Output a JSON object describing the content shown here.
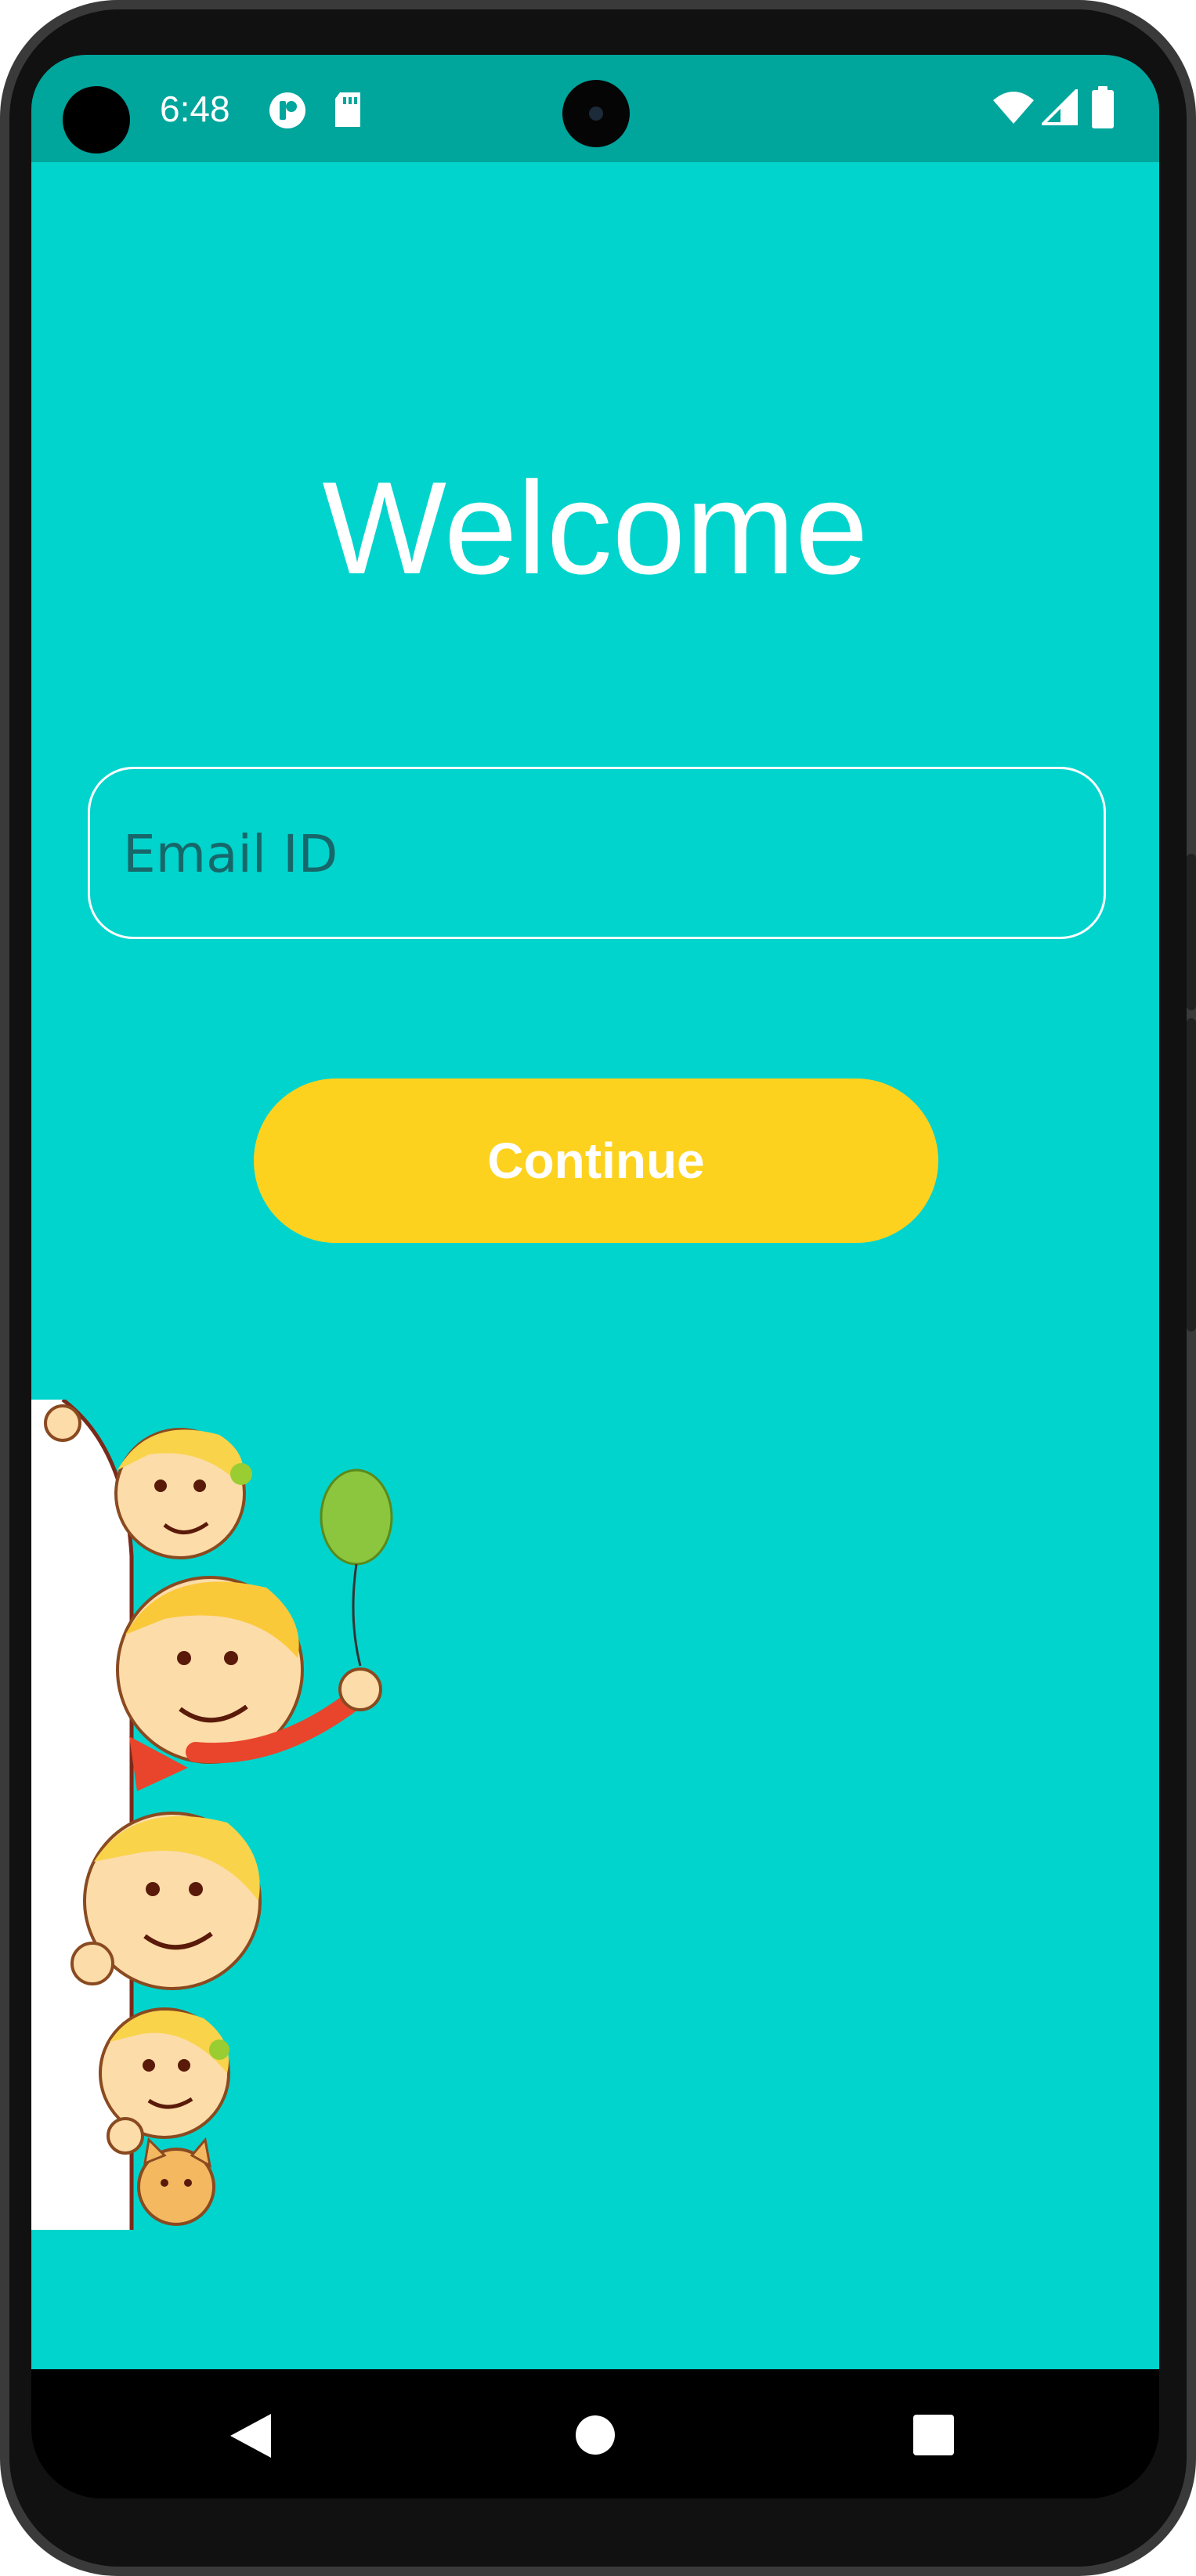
{
  "status_bar": {
    "time": "6:48",
    "icons": [
      "app-notification-icon",
      "sd-card-icon",
      "wifi-icon",
      "cellular-signal-icon",
      "battery-icon"
    ]
  },
  "welcome_screen": {
    "title": "Welcome",
    "email_field": {
      "placeholder": "Email ID",
      "value": ""
    },
    "continue_button": {
      "label": "Continue"
    },
    "illustration": "peeking-kids-illustration"
  },
  "navigation_bar": {
    "buttons": [
      "back-icon",
      "home-icon",
      "recents-icon"
    ]
  },
  "colors": {
    "background": "#00D4CD",
    "status_bar": "#00A59C",
    "button": "#FDD21F",
    "text": "#FFFFFF"
  }
}
